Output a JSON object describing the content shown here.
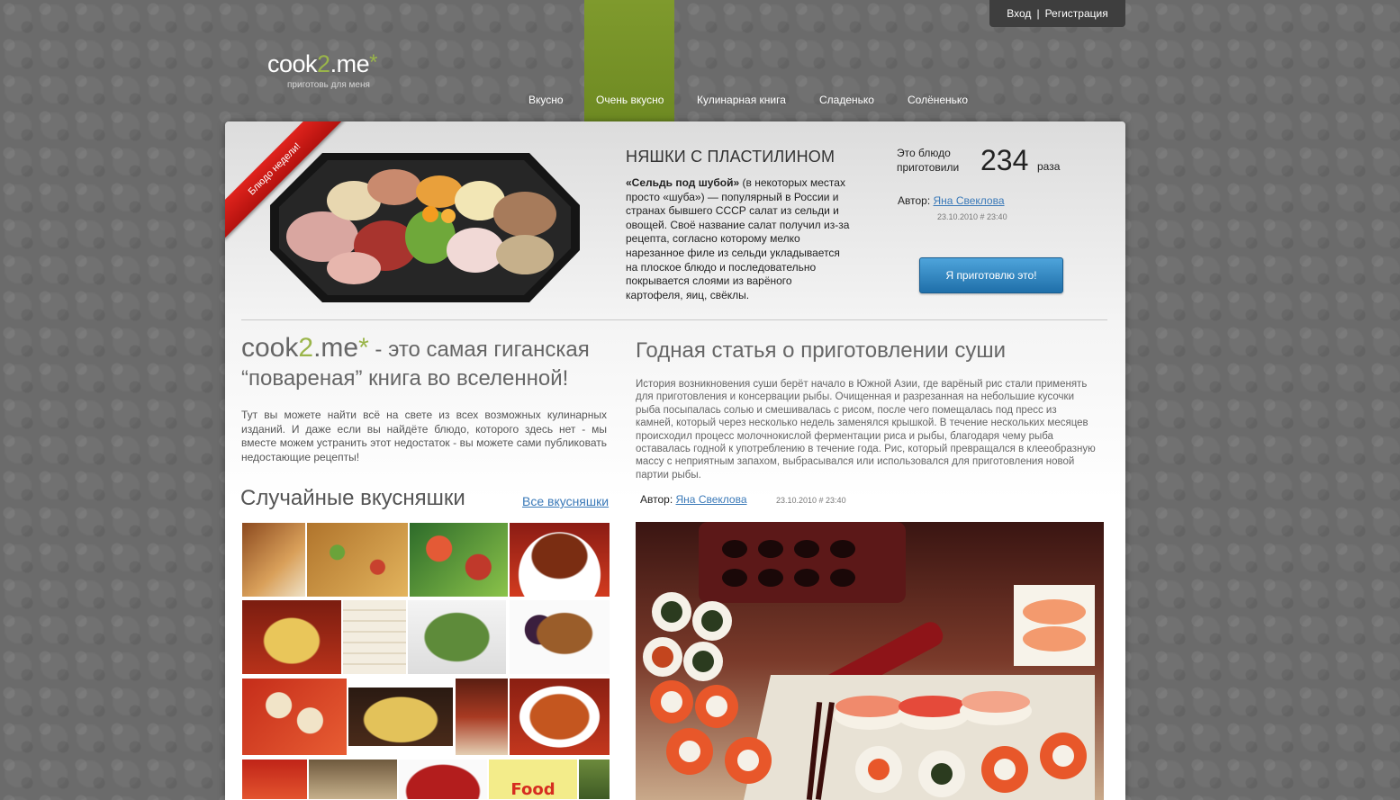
{
  "header": {
    "login": "Вход",
    "separator": "|",
    "register": "Регистрация",
    "logo_pre": "cook",
    "logo_two": "2",
    "logo_post": ".me",
    "logo_star": "*",
    "tagline": "приготовь для меня"
  },
  "nav": {
    "items": [
      "Вкусно",
      "Очень вкусно",
      "Кулинарная книга",
      "Сладенько",
      "Солёненько"
    ],
    "active_index": 1
  },
  "featured": {
    "ribbon": "Блюдо недели!",
    "title": "НЯШКИ С ПЛАСТИЛИНОМ",
    "desc_bold": "«Сельдь под шубой»",
    "desc_rest": " (в некоторых местах просто «шуба») — популярный в России и странах бывшего СССР салат из сельди и овощей. Своё название салат получил из-за рецепта, согласно которому мелко нарезанное филе из сельди укладывается на плоское блюдо и последовательно покрывается слоями из варёного картофеля, яиц, свёклы.",
    "cooked_label": "Это блюдо приготовили",
    "cooked_count": "234",
    "cooked_unit": "раза",
    "author_label": "Автор:",
    "author_name": "Яна Свеклова",
    "date": "23.10.2010 # 23:40",
    "button": "Я приготовлю это!"
  },
  "promo": {
    "brand_pre": "cook",
    "brand_two": "2",
    "brand_post": ".me",
    "brand_star": "*",
    "headline": " - это самая гиганская “повареная” книга во вселенной!",
    "text": "Тут вы можете найти всё на свете из всех возможных кулинарных изданий. И даже если вы найдёте блюдо, которого здесь нет - мы вместе можем устранить этот недостаток - вы можете сами публиковать недостающие рецепты!"
  },
  "random": {
    "title": "Случайные вкусняшки",
    "all_link": "Все вкусняшки",
    "thumb_text": "Food"
  },
  "article": {
    "title": "Годная статья о приготовлении суши",
    "text": "История возникновения суши берёт начало в Южной Азии, где варёный рис стали применять для приготовления и консервации рыбы. Очищенная и разрезанная на небольшие кусочки рыба посыпалась солью и смешивалась с рисом, после чего помещалась под пресс из камней, который через несколько недель заменялся крышкой. В течение нескольких месяцев происходил процесс молочнокислой ферментации риса и рыбы, благодаря чему рыба оставалась годной к употреблению в течение года. Рис, который превращался в клееобразную массу с неприятным запахом, выбрасывался или использовался для приготовления новой партии рыбы.",
    "author_label": "Автор:",
    "author_name": "Яна Свеклова",
    "date": "23.10.2010 # 23:40"
  },
  "colors": {
    "accent_green": "#7f9a2d",
    "link_blue": "#3a79b8",
    "ribbon_red": "#d01c17",
    "button_blue": "#2f86c2"
  }
}
